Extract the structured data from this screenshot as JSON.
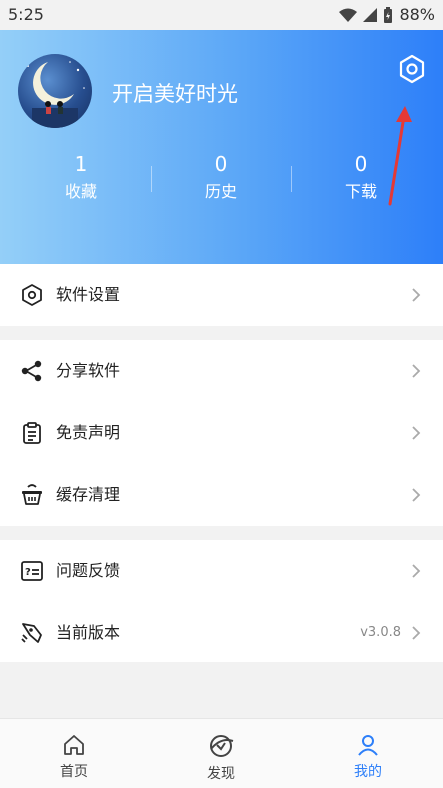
{
  "status_bar": {
    "time": "5:25",
    "battery": "88%"
  },
  "profile": {
    "name": "开启美好时光"
  },
  "stats": [
    {
      "count": "1",
      "label": "收藏"
    },
    {
      "count": "0",
      "label": "历史"
    },
    {
      "count": "0",
      "label": "下载"
    }
  ],
  "menu": {
    "group1": [
      {
        "label": "软件设置",
        "icon": "settings-hex-icon"
      }
    ],
    "group2": [
      {
        "label": "分享软件",
        "icon": "share-icon"
      },
      {
        "label": "免责声明",
        "icon": "clipboard-icon"
      },
      {
        "label": "缓存清理",
        "icon": "basket-icon"
      }
    ],
    "group3": [
      {
        "label": "问题反馈",
        "icon": "feedback-icon"
      },
      {
        "label": "当前版本",
        "icon": "rocket-icon",
        "value": "v3.0.8"
      }
    ]
  },
  "tabbar": [
    {
      "label": "首页",
      "icon": "home-icon"
    },
    {
      "label": "发现",
      "icon": "discover-icon"
    },
    {
      "label": "我的",
      "icon": "user-icon",
      "active": true
    }
  ],
  "colors": {
    "accent": "#2d7ff9",
    "header_start": "#94cff8",
    "header_end": "#2d7ff9",
    "arrow": "#e53935"
  }
}
